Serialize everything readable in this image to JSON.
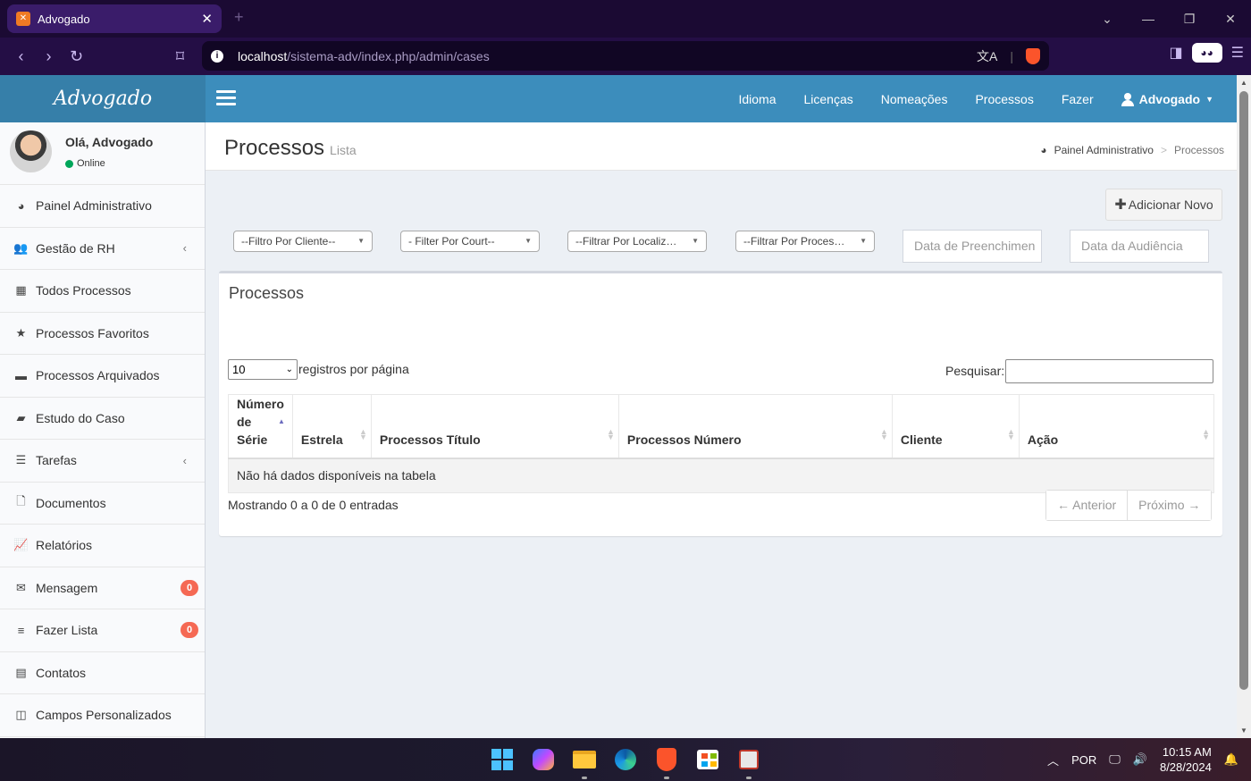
{
  "browser": {
    "tab_title": "Advogado",
    "favicon_text": "ꟷ",
    "url_host": "localhost",
    "url_path": "/sistema-adv/index.php/admin/cases"
  },
  "app": {
    "logo": "Advogado",
    "top_menu": [
      "Idioma",
      "Licenças",
      "Nomeações",
      "Processos",
      "Fazer"
    ],
    "user_menu": "Advogado"
  },
  "sidebar": {
    "user_name": "Olá, Advogado",
    "user_status": "Online",
    "items": [
      {
        "label": "Painel Administrativo",
        "icon": "dashboard-icon",
        "glyph": "◕"
      },
      {
        "label": "Gestão de RH",
        "icon": "users-icon",
        "glyph": "👥",
        "chevron": "‹"
      },
      {
        "label": "Todos Processos",
        "icon": "grid-icon",
        "glyph": "▦"
      },
      {
        "label": "Processos Favoritos",
        "icon": "star-icon",
        "glyph": "★"
      },
      {
        "label": "Processos Arquivados",
        "icon": "archive-icon",
        "glyph": "▬"
      },
      {
        "label": "Estudo do Caso",
        "icon": "book-icon",
        "glyph": "▰"
      },
      {
        "label": "Tarefas",
        "icon": "tasks-icon",
        "glyph": "☰",
        "chevron": "‹"
      },
      {
        "label": "Documentos",
        "icon": "file-icon",
        "glyph": "🗋"
      },
      {
        "label": "Relatórios",
        "icon": "chart-icon",
        "glyph": "📈"
      },
      {
        "label": "Mensagem",
        "icon": "envelope-icon",
        "glyph": "✉",
        "badge": "0"
      },
      {
        "label": "Fazer Lista",
        "icon": "list-icon",
        "glyph": "≡",
        "badge": "0"
      },
      {
        "label": "Contatos",
        "icon": "contacts-icon",
        "glyph": "▤"
      },
      {
        "label": "Campos Personalizados",
        "icon": "columns-icon",
        "glyph": "◫"
      }
    ]
  },
  "header": {
    "title": "Processos",
    "subtitle": "Lista",
    "breadcrumb_home": "Painel Administrativo",
    "breadcrumb_sep": ">",
    "breadcrumb_current": "Processos"
  },
  "toolbar": {
    "add_label": "Adicionar Novo",
    "add_plus": "✚"
  },
  "filters": {
    "client": "--Filtro Por Cliente--",
    "court": "- Filter Por Court--",
    "location": "--Filtrar Por Localiz…",
    "process": "--Filtrar Por Proces…",
    "filing_date_placeholder": "Data de Preenchimen",
    "hearing_date_placeholder": "Data da Audiência"
  },
  "table_box": {
    "title": "Processos",
    "length_value": "10",
    "length_label": "registros por página",
    "search_label": "Pesquisar:",
    "search_value": "",
    "columns": [
      "Número de Série",
      "Estrela",
      "Processos Título",
      "Processos Número",
      "Cliente",
      "Ação"
    ],
    "empty_message": "Não há dados disponíveis na tabela",
    "info": "Mostrando 0 a 0 de 0 entradas",
    "prev_label": "← Anterior",
    "next_label": "Próximo →"
  },
  "taskbar": {
    "language": "POR",
    "time": "10:15 AM",
    "date": "8/28/2024"
  },
  "colors": {
    "header_blue": "#3c8dbc",
    "logo_blue": "#367fa9",
    "badge_red": "#f56954",
    "online_green": "#00a65a"
  }
}
